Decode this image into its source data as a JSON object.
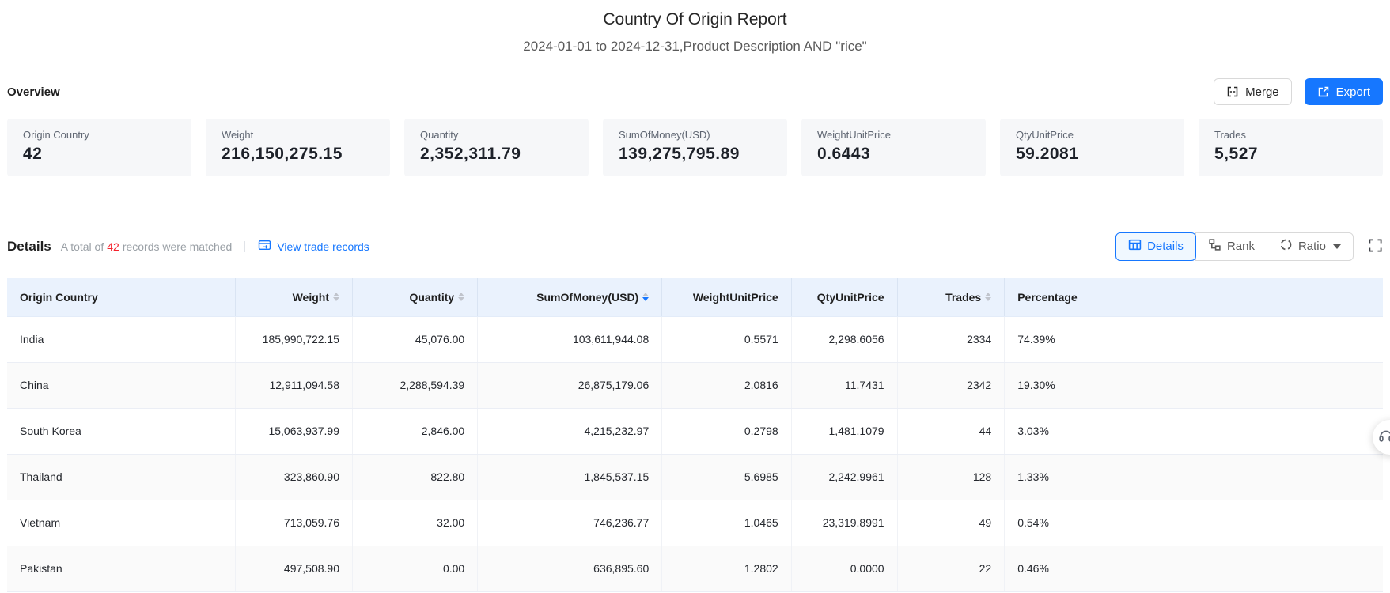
{
  "report": {
    "title": "Country Of Origin Report",
    "subtitle": "2024-01-01 to 2024-12-31,Product Description AND \"rice\""
  },
  "overview": {
    "label": "Overview",
    "merge_label": "Merge",
    "export_label": "Export",
    "cards": [
      {
        "label": "Origin Country",
        "value": "42"
      },
      {
        "label": "Weight",
        "value": "216,150,275.15"
      },
      {
        "label": "Quantity",
        "value": "2,352,311.79"
      },
      {
        "label": "SumOfMoney(USD)",
        "value": "139,275,795.89"
      },
      {
        "label": "WeightUnitPrice",
        "value": "0.6443"
      },
      {
        "label": "QtyUnitPrice",
        "value": "59.2081"
      },
      {
        "label": "Trades",
        "value": "5,527"
      }
    ]
  },
  "details": {
    "label": "Details",
    "matched_prefix": "A total of",
    "matched_count": "42",
    "matched_suffix": "records were matched",
    "view_link": "View trade records",
    "tabs": [
      {
        "label": "Details",
        "icon": "table-icon",
        "active": true
      },
      {
        "label": "Rank",
        "icon": "rank-icon",
        "active": false
      },
      {
        "label": "Ratio",
        "icon": "ratio-icon",
        "active": false,
        "dropdown": true
      }
    ]
  },
  "table": {
    "columns": [
      {
        "key": "country",
        "label": "Origin Country",
        "align": "left",
        "sortable": false,
        "width": "16.6%"
      },
      {
        "key": "weight",
        "label": "Weight",
        "align": "right",
        "sortable": true,
        "width": "8.5%"
      },
      {
        "key": "quantity",
        "label": "Quantity",
        "align": "right",
        "sortable": true,
        "width": "9.1%"
      },
      {
        "key": "sum",
        "label": "SumOfMoney(USD)",
        "align": "right",
        "sortable": true,
        "sort": "desc",
        "width": "13.4%"
      },
      {
        "key": "wup",
        "label": "WeightUnitPrice",
        "align": "right",
        "sortable": false,
        "width": "9.4%"
      },
      {
        "key": "qup",
        "label": "QtyUnitPrice",
        "align": "right",
        "sortable": false,
        "width": "7.7%"
      },
      {
        "key": "trades",
        "label": "Trades",
        "align": "right",
        "sortable": true,
        "width": "7.8%"
      },
      {
        "key": "pct",
        "label": "Percentage",
        "align": "left",
        "sortable": false,
        "width": ""
      }
    ],
    "rows": [
      [
        "India",
        "185,990,722.15",
        "45,076.00",
        "103,611,944.08",
        "0.5571",
        "2,298.6056",
        "2334",
        "74.39%"
      ],
      [
        "China",
        "12,911,094.58",
        "2,288,594.39",
        "26,875,179.06",
        "2.0816",
        "11.7431",
        "2342",
        "19.30%"
      ],
      [
        "South Korea",
        "15,063,937.99",
        "2,846.00",
        "4,215,232.97",
        "0.2798",
        "1,481.1079",
        "44",
        "3.03%"
      ],
      [
        "Thailand",
        "323,860.90",
        "822.80",
        "1,845,537.15",
        "5.6985",
        "2,242.9961",
        "128",
        "1.33%"
      ],
      [
        "Vietnam",
        "713,059.76",
        "32.00",
        "746,236.77",
        "1.0465",
        "23,319.8991",
        "49",
        "0.54%"
      ],
      [
        "Pakistan",
        "497,508.90",
        "0.00",
        "636,895.60",
        "1.2802",
        "0.0000",
        "22",
        "0.46%"
      ]
    ]
  },
  "colors": {
    "accent_blue": "#1677ff",
    "active_tab_bg": "#f0f8ff",
    "table_header_bg": "#eaf2fd",
    "striped_row_bg": "#fafafa",
    "matched_count_red": "#f5222d"
  }
}
